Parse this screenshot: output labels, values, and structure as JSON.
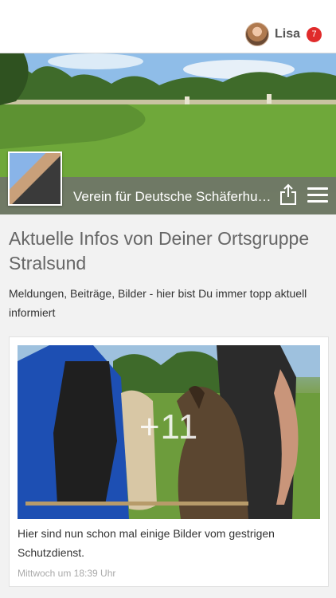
{
  "header": {
    "user_name": "Lisa",
    "notification_count": "7"
  },
  "club": {
    "name": "Verein für Deutsche Schäferhunde"
  },
  "section": {
    "title": "Aktuelle Infos von Deiner Ortsgruppe Stralsund",
    "subtitle": "Meldungen, Beiträge, Bilder - hier bist Du immer topp aktuell informiert"
  },
  "post": {
    "photo_count": "+11",
    "text": "Hier sind nun schon mal einige Bilder vom gestrigen Schutzdienst.",
    "timestamp": "Mittwoch um 18:39 Uhr"
  },
  "colors": {
    "badge": "#e02b2b",
    "hero_bar": "#6e6e6e",
    "background": "#f2f2f2"
  },
  "icons": [
    "avatar",
    "share-icon",
    "hamburger-menu-icon"
  ]
}
